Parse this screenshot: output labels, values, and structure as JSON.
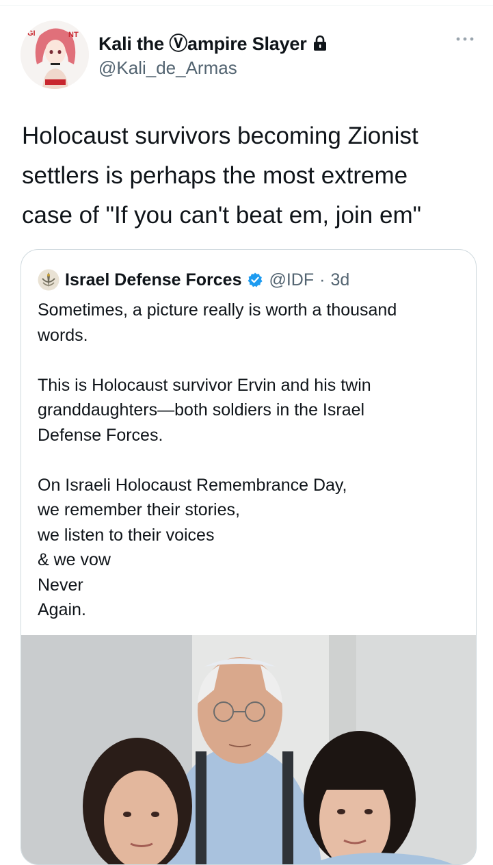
{
  "author": {
    "display_name": "Kali the Ⓥampire Slayer",
    "handle": "@Kali_de_Armas",
    "avatar_icon": "anime-avatar-icon",
    "lock_icon": "lock-icon"
  },
  "tweet": {
    "text": "Holocaust survivors becoming Zionist\nsettlers is perhaps the most extreme\ncase of \"If you can't beat em, join em\""
  },
  "quoted_tweet": {
    "display_name": "Israel Defense Forces",
    "handle": "@IDF",
    "separator": "·",
    "time": "3d",
    "logo_icon": "idf-logo-icon",
    "verified_icon": "verified-badge-icon",
    "text": "Sometimes, a picture really is worth a thousand\nwords.\n\nThis is Holocaust survivor Ervin and his twin\ngranddaughters—both soldiers in the Israel\nDefense Forces.\n\nOn Israeli Holocaust Remembrance Day,\nwe remember their stories,\nwe listen to their voices\n& we vow\nNever\nAgain.",
    "photo_icon": "photo-elderly-man-and-two-granddaughters"
  },
  "colors": {
    "text_primary": "#0f1419",
    "text_secondary": "#536471",
    "border": "#cfd9de",
    "verified_blue": "#1d9bf0"
  }
}
